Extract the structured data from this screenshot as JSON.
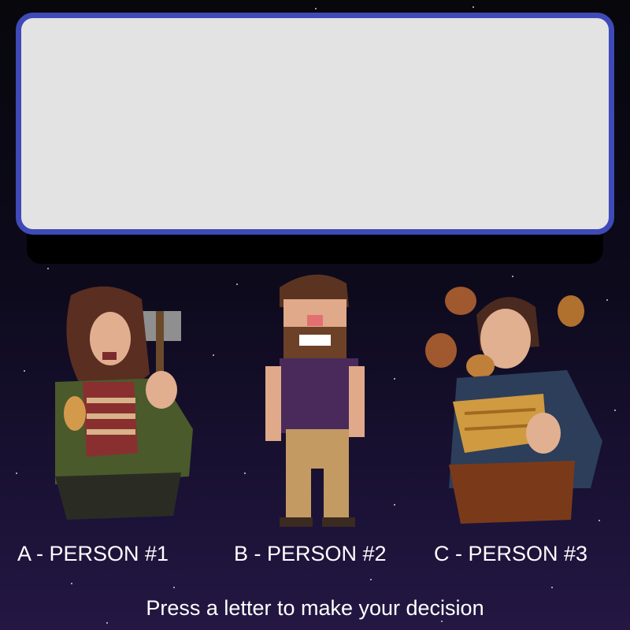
{
  "dialog": {
    "text": ""
  },
  "characters": [
    {
      "key": "A",
      "label": "A - PERSON #1"
    },
    {
      "key": "B",
      "label": "B - PERSON #2"
    },
    {
      "key": "C",
      "label": "C - PERSON #3"
    }
  ],
  "instructions": "Press a letter to make your decision",
  "colors": {
    "dialog_border": "#3f4ab8",
    "dialog_fill": "#e3e3e3",
    "background": "#0d0a1c",
    "text": "#ffffff"
  }
}
